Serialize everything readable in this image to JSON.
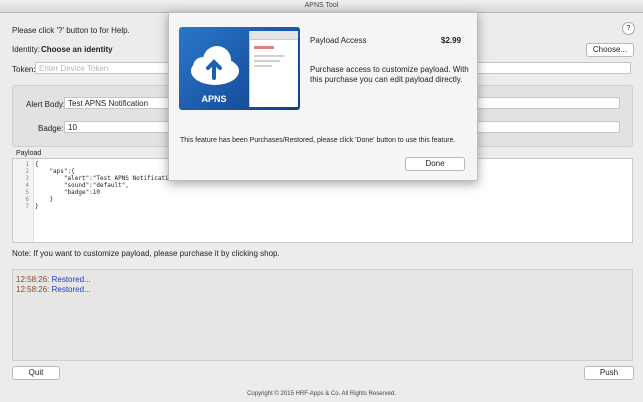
{
  "window": {
    "title": "APNS Tool"
  },
  "help": {
    "text": "Please click '?' button to for Help.",
    "button_label": "?"
  },
  "identity": {
    "label": "Identity:",
    "value": "Choose an identity",
    "button_label": "Choose..."
  },
  "token": {
    "label": "Token:",
    "placeholder": "Enter Device Token"
  },
  "alert": {
    "label": "Alert Body:",
    "value": "Test APNS Notification"
  },
  "badge": {
    "label": "Badge:",
    "value": "10"
  },
  "payload": {
    "label": "Payload",
    "lines": [
      {
        "n": "1",
        "code": "{"
      },
      {
        "n": "2",
        "code": "    \"aps\":{"
      },
      {
        "n": "3",
        "code": "        \"alert\":\"Test APNS Notification\","
      },
      {
        "n": "4",
        "code": "        \"sound\":\"default\","
      },
      {
        "n": "5",
        "code": "        \"badge\":10"
      },
      {
        "n": "6",
        "code": "    }"
      },
      {
        "n": "7",
        "code": "}"
      }
    ]
  },
  "note": "Note: If you want to customize payload, please purchase it by clicking shop.",
  "log": [
    {
      "time": "12:58:26:",
      "msg": "Restored..."
    },
    {
      "time": "12:58:26:",
      "msg": "Restored..."
    }
  ],
  "buttons": {
    "quit": "Quit",
    "push": "Push"
  },
  "footer": "Copyright © 2015 HRF-Apps & Co. All Rights Reserved.",
  "dialog": {
    "product_name": "Payload Access",
    "price": "$2.99",
    "description": "Purchase access to customize payload.  With this purchase you can edit payload directly.",
    "status": "This feature has been Purchases/Restored, please click 'Done' button to use this feature.",
    "done_label": "Done",
    "image_text": "APNS"
  },
  "colors": {
    "accent": "#1f3ec2",
    "image_blue": "#2a77c9"
  }
}
